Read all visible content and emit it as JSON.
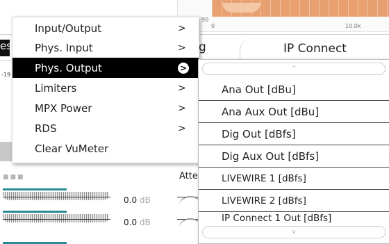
{
  "background": {
    "graph": {
      "tick_low": "90",
      "tick_zero": "0",
      "tick_high": "10.0k",
      "fill_color": "#e8a070"
    },
    "tabs": {
      "left_fragment": "es",
      "middle_fragment": "g",
      "ip_connect": "IP Connect"
    },
    "scale_tick": "-19",
    "panel_dots": "■■■",
    "atten_fragment": "Atte",
    "meters": [
      {
        "value": "0.0",
        "unit": "dB"
      },
      {
        "value": "0.0",
        "unit": "dB"
      }
    ],
    "accent_color": "#2a8a9a"
  },
  "context_menu": {
    "items": [
      {
        "label": "Input/Output",
        "arrow": ">",
        "active": false
      },
      {
        "label": "Phys. Input",
        "arrow": ">",
        "active": false
      },
      {
        "label": "Phys. Output",
        "arrow": ">",
        "active": true
      },
      {
        "label": "Limiters",
        "arrow": ">",
        "active": false
      },
      {
        "label": "MPX Power",
        "arrow": ">",
        "active": false
      },
      {
        "label": "RDS",
        "arrow": ">",
        "active": false
      },
      {
        "label": "Clear VuMeter",
        "arrow": "",
        "active": false
      }
    ]
  },
  "submenu": {
    "scroll_up": "^",
    "scroll_down": "v",
    "items": [
      {
        "label": "Ana Out [dBu]"
      },
      {
        "label": "Ana Aux Out [dBu]"
      },
      {
        "label": "Dig Out [dBfs]"
      },
      {
        "label": "Dig Aux Out [dBfs]"
      },
      {
        "label": "LIVEWIRE 1 [dBfs]"
      },
      {
        "label": "LIVEWIRE 2 [dBfs]"
      },
      {
        "label": "IP Connect 1 Out [dBfs]"
      }
    ]
  }
}
